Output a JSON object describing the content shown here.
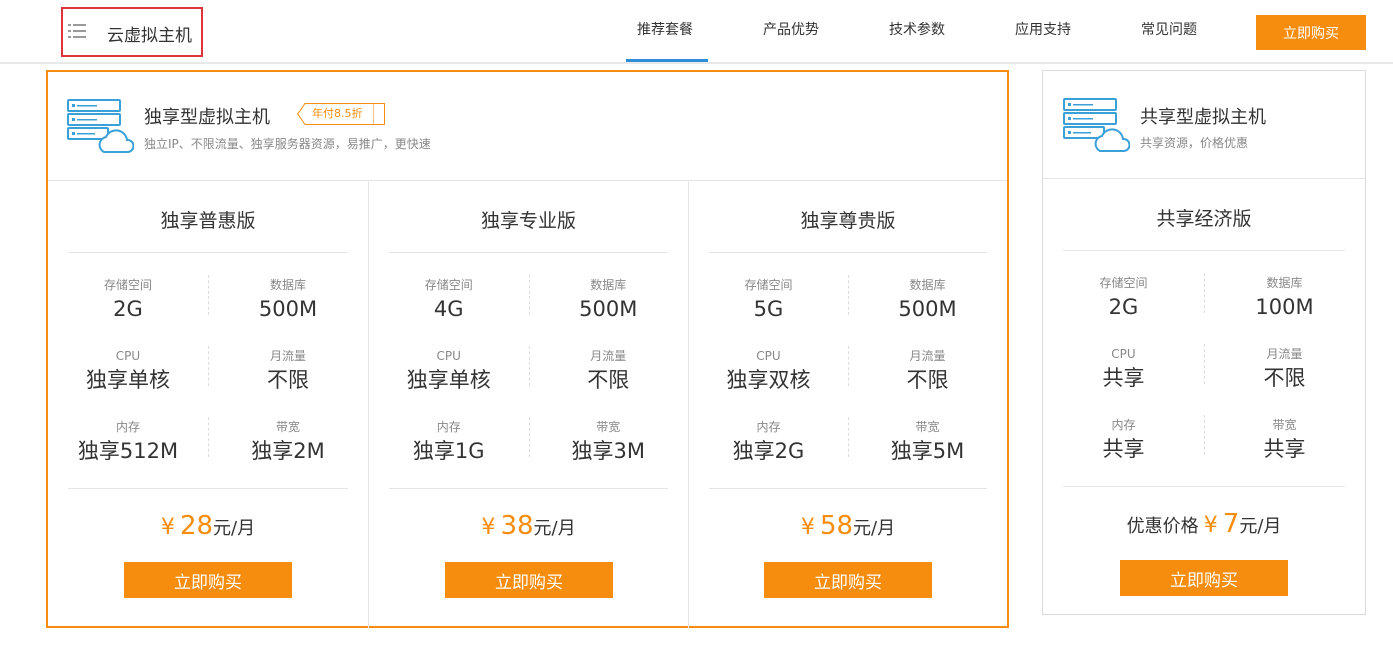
{
  "header": {
    "brand_title": "云虚拟主机",
    "nav": [
      "推荐套餐",
      "产品优势",
      "技术参数",
      "应用支持",
      "常见问题"
    ],
    "buy_label": "立即购买"
  },
  "exclusive": {
    "title": "独享型虚拟主机",
    "discount": "年付8.5折",
    "subtitle": "独立IP、不限流量、独享服务器资源，易推广，更快速",
    "plans": [
      {
        "name": "独享普惠版",
        "specs": [
          {
            "label": "存储空间",
            "value": "2G"
          },
          {
            "label": "数据库",
            "value": "500M"
          },
          {
            "label": "CPU",
            "value": "独享单核"
          },
          {
            "label": "月流量",
            "value": "不限"
          },
          {
            "label": "内存",
            "value": "独享512M"
          },
          {
            "label": "带宽",
            "value": "独享2M"
          }
        ],
        "price_currency": "¥",
        "price": "28",
        "price_unit": "元/月",
        "buy_label": "立即购买"
      },
      {
        "name": "独享专业版",
        "specs": [
          {
            "label": "存储空间",
            "value": "4G"
          },
          {
            "label": "数据库",
            "value": "500M"
          },
          {
            "label": "CPU",
            "value": "独享单核"
          },
          {
            "label": "月流量",
            "value": "不限"
          },
          {
            "label": "内存",
            "value": "独享1G"
          },
          {
            "label": "带宽",
            "value": "独享3M"
          }
        ],
        "price_currency": "¥",
        "price": "38",
        "price_unit": "元/月",
        "buy_label": "立即购买"
      },
      {
        "name": "独享尊贵版",
        "specs": [
          {
            "label": "存储空间",
            "value": "5G"
          },
          {
            "label": "数据库",
            "value": "500M"
          },
          {
            "label": "CPU",
            "value": "独享双核"
          },
          {
            "label": "月流量",
            "value": "不限"
          },
          {
            "label": "内存",
            "value": "独享2G"
          },
          {
            "label": "带宽",
            "value": "独享5M"
          }
        ],
        "price_currency": "¥",
        "price": "58",
        "price_unit": "元/月",
        "buy_label": "立即购买"
      }
    ]
  },
  "shared": {
    "title": "共享型虚拟主机",
    "subtitle": "共享资源，价格优惠",
    "plan": {
      "name": "共享经济版",
      "specs": [
        {
          "label": "存储空间",
          "value": "2G"
        },
        {
          "label": "数据库",
          "value": "100M"
        },
        {
          "label": "CPU",
          "value": "共享"
        },
        {
          "label": "月流量",
          "value": "不限"
        },
        {
          "label": "内存",
          "value": "共享"
        },
        {
          "label": "带宽",
          "value": "共享"
        }
      ],
      "price_prefix": "优惠价格",
      "price_currency": "¥",
      "price": "7",
      "price_unit": "元/月",
      "buy_label": "立即购买"
    }
  },
  "colors": {
    "accent": "#f68d0e",
    "nav_active": "#2d8fd8",
    "icon_blue": "#3aa0d8",
    "highlight_box": "#e0333c"
  },
  "icons": {
    "menu": "list-menu-icon",
    "server": "server-cloud-icon"
  }
}
